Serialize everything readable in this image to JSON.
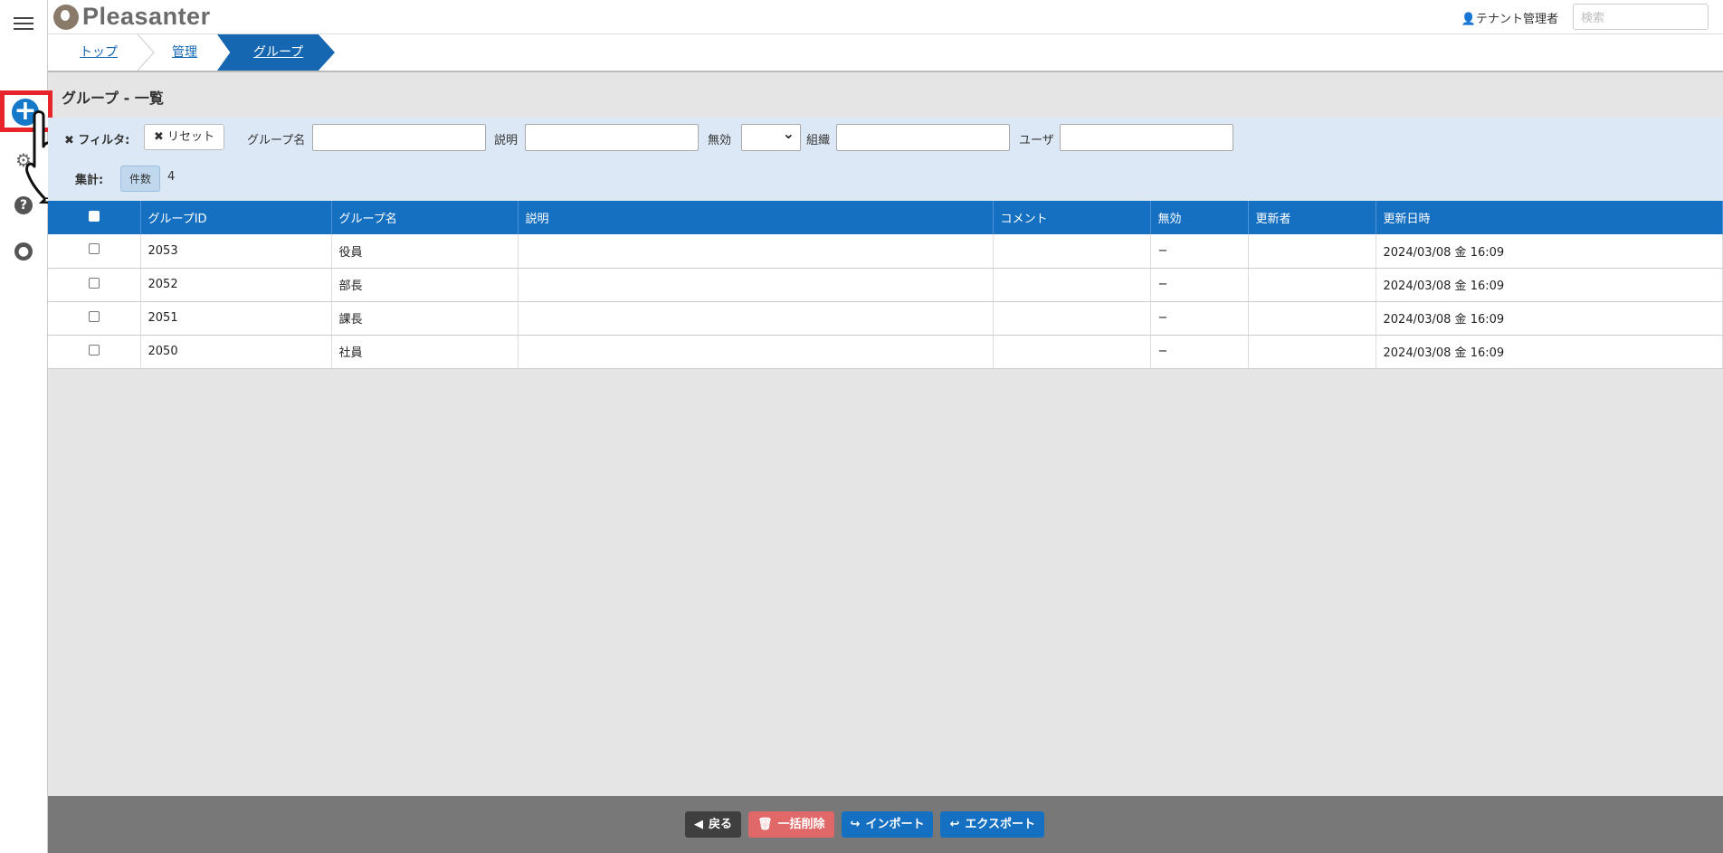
{
  "header": {
    "logo_text": "Pleasanter",
    "tenant_label": "テナント管理者",
    "search_placeholder": "検索"
  },
  "breadcrumb": {
    "items": [
      "トップ",
      "管理",
      "グループ"
    ]
  },
  "page": {
    "title": "グループ - 一覧"
  },
  "filters": {
    "filter_label": "フィルタ:",
    "reset_label": "リセット",
    "group_name_label": "グループ名",
    "description_label": "説明",
    "disabled_label": "無効",
    "organization_label": "組織",
    "user_label": "ユーザ",
    "aggregation_label": "集計:",
    "count_badge": "件数",
    "count_value": "4"
  },
  "table": {
    "columns": [
      "グループID",
      "グループ名",
      "説明",
      "コメント",
      "無効",
      "更新者",
      "更新日時"
    ],
    "rows": [
      {
        "id": "2053",
        "name": "役員",
        "description": "",
        "comment": "",
        "disabled": "−",
        "updater": "",
        "updated": "2024/03/08 金 16:09"
      },
      {
        "id": "2052",
        "name": "部長",
        "description": "",
        "comment": "",
        "disabled": "−",
        "updater": "",
        "updated": "2024/03/08 金 16:09"
      },
      {
        "id": "2051",
        "name": "課長",
        "description": "",
        "comment": "",
        "disabled": "−",
        "updater": "",
        "updated": "2024/03/08 金 16:09"
      },
      {
        "id": "2050",
        "name": "社員",
        "description": "",
        "comment": "",
        "disabled": "−",
        "updater": "",
        "updated": "2024/03/08 金 16:09"
      }
    ]
  },
  "footer": {
    "back_label": "戻る",
    "bulk_delete_label": "一括削除",
    "import_label": "インポート",
    "export_label": "エクスポート"
  },
  "colors": {
    "accent": "#1670c2",
    "highlight_box": "#e8242b",
    "delete_button": "#e06868",
    "filter_bg": "#dce8f5"
  }
}
